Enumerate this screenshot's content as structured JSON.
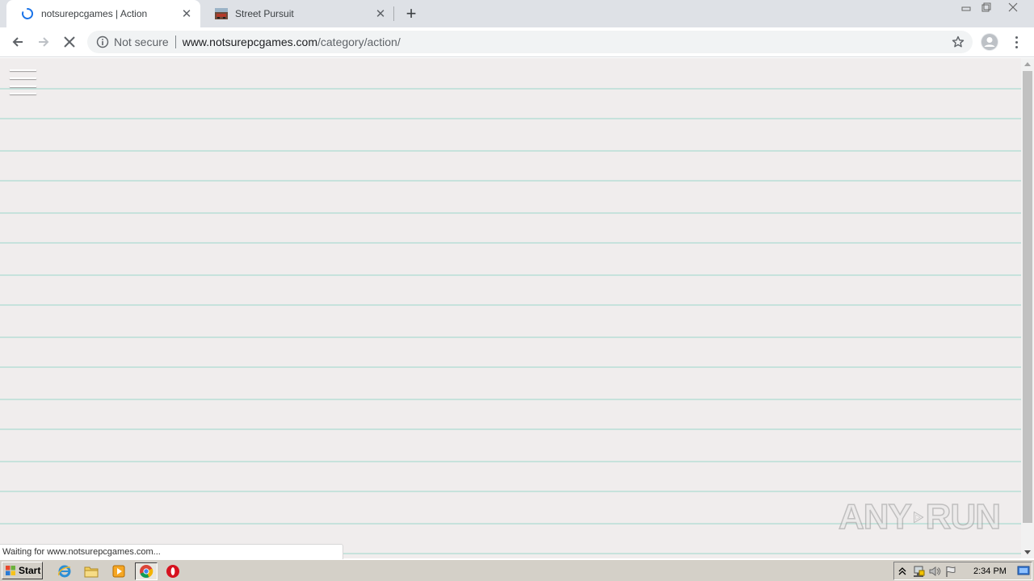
{
  "tabs": [
    {
      "title": "notsurepcgames | Action",
      "active": true,
      "loading": true,
      "favicon": "loading-spinner-icon"
    },
    {
      "title": "Street Pursuit",
      "active": false,
      "loading": false,
      "favicon": "game-thumbnail-icon"
    }
  ],
  "toolbar": {
    "security_label": "Not secure",
    "url_host": "www.notsurepcgames.com",
    "url_path": "/category/action/"
  },
  "status": {
    "text": "Waiting for www.notsurepcgames.com..."
  },
  "watermark": {
    "left": "ANY",
    "right": "RUN"
  },
  "taskbar": {
    "start_label": "Start",
    "pinned": [
      "internet-explorer-icon",
      "file-explorer-icon",
      "media-player-icon",
      "chrome-icon",
      "opera-icon"
    ],
    "clock": "2:34 PM"
  },
  "colors": {
    "page_background": "#f0eded",
    "line_color": "#c6e2dc",
    "tabstrip": "#dee1e6"
  }
}
